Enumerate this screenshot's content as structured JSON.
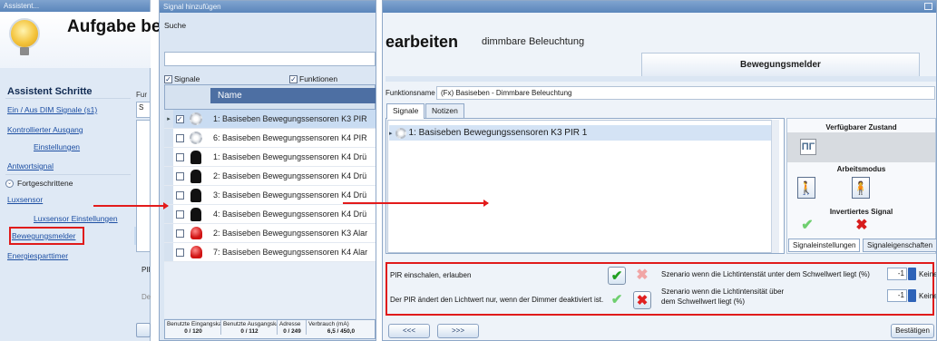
{
  "left_window": {
    "title": "Assistent...",
    "heading": "Aufgabe bea",
    "steps_heading": "Assistent Schritte",
    "steps": [
      {
        "label": "Ein / Aus DIM Signale (s1)"
      },
      {
        "label": "Kontrollierter Ausgang"
      },
      {
        "label": "Einstellungen"
      },
      {
        "label": "Antwortsignal"
      },
      {
        "label": "Luxsensor"
      },
      {
        "label": "Luxsensor Einstellungen"
      },
      {
        "label": "Bewegungsmelder"
      },
      {
        "label": "Energiesparttimer"
      }
    ],
    "advanced_label": "Fortgeschrittene",
    "clipped": {
      "fu": "Fur",
      "s": "S",
      "pi": "PII",
      "de": "De"
    }
  },
  "middle_window": {
    "title": "Signal hinzufügen",
    "search_label": "Suche",
    "search_value": "",
    "check_signals": "Signale",
    "check_functions": "Funktionen",
    "column_name": "Name",
    "rows": [
      {
        "name": "1: Basiseben Bewegungssensoren K3 PIR",
        "icon": "motion-sensor-icon",
        "checked": true,
        "selected": true
      },
      {
        "name": "6: Basiseben Bewegungssensoren K4 PIR",
        "icon": "motion-sensor-icon",
        "checked": false,
        "selected": false
      },
      {
        "name": "1: Basiseben Bewegungssensoren K4 Drü",
        "icon": "pushbutton-icon",
        "checked": false,
        "selected": false
      },
      {
        "name": "2: Basiseben Bewegungssensoren K4 Drü",
        "icon": "pushbutton-icon",
        "checked": false,
        "selected": false
      },
      {
        "name": "3: Basiseben Bewegungssensoren K4 Drü",
        "icon": "pushbutton-icon",
        "checked": false,
        "selected": false
      },
      {
        "name": "4: Basiseben Bewegungssensoren K4 Drü",
        "icon": "pushbutton-icon",
        "checked": false,
        "selected": false
      },
      {
        "name": "2: Basiseben Bewegungssensoren K3 Alar",
        "icon": "alarm-icon",
        "checked": false,
        "selected": false
      },
      {
        "name": "7: Basiseben Bewegungssensoren K4 Alar",
        "icon": "alarm-icon",
        "checked": false,
        "selected": false
      }
    ],
    "footer": {
      "headers": [
        "Benutzte Eingangskanäle",
        "Benutzte Ausgangskanäle",
        "Adresse",
        "Verbrauch (mA)"
      ],
      "values": [
        "0 / 120",
        "0 / 112",
        "0 / 249",
        "6,5 / 450,0"
      ]
    }
  },
  "right_window": {
    "title": "earbeiten",
    "subtitle": "dimmbare Beleuchtung",
    "section_tab": "Bewegungsmelder",
    "function_label": "Funktionsname",
    "function_value": "(Fx) Basiseben - Dimmbare Beleuchtung",
    "tabs": [
      "Signale",
      "Notizen"
    ],
    "signal_item": "1: Basiseben Bewegungssensoren K3 PIR 1",
    "props": {
      "available_state": "Verfügbarer Zustand",
      "work_mode": "Arbeitsmodus",
      "inverted_signal": "Invertiertes Signal",
      "tab_settings": "Signaleinstellungen",
      "tab_properties": "Signaleigenschaften"
    },
    "options": {
      "pir_enable": "PIR einschalen, erlauben",
      "pir_changes": "Der PIR ändert den Lichtwert nur, wenn der Dimmer deaktiviert ist.",
      "scenario_below": "Szenario wenn die Lichtintenstät unter dem Schwellwert liegt (%)",
      "scenario_above_1": "Szenario wenn die Lichtintensität über",
      "scenario_above_2": "dem Schwellwert liegt (%)",
      "value_below": "-1",
      "value_above": "-1",
      "suffix_below": "Keine",
      "suffix_above": "Keine"
    },
    "buttons": {
      "prev": "<<<",
      "next": ">>>",
      "confirm": "Bestätigen"
    }
  },
  "colors": {
    "highlight": "#e01b1b",
    "arrow": "#e31b1b",
    "header_blue": "#4d6fa3"
  }
}
